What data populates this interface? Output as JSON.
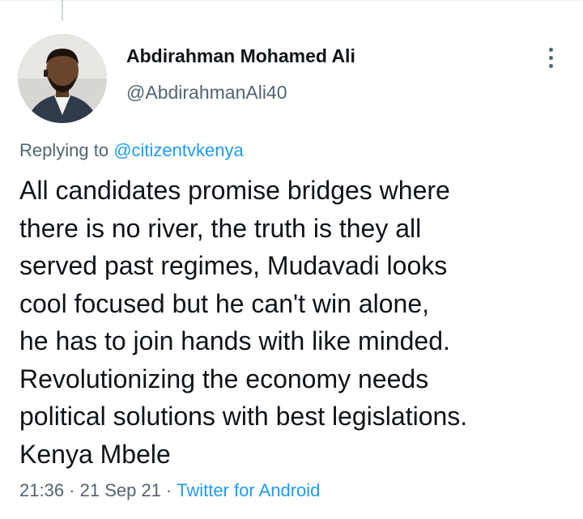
{
  "tweet": {
    "author": {
      "name": "Abdirahman Mohamed Ali",
      "handle": "@AbdirahmanAli40"
    },
    "replying_prefix": "Replying to ",
    "replying_to": "@citizentvkenya",
    "text": "All candidates promise bridges where\nthere is no river, the truth is they all\nserved past regimes, Mudavadi looks\ncool focused but he can't win alone,\nhe has to join hands with like minded.\nRevolutionizing the economy needs\npolitical solutions with best legislations.\nKenya Mbele",
    "time": "21:36",
    "separator": " · ",
    "date": "21 Sep 21",
    "source": "Twitter for Android"
  },
  "icons": {
    "more": "more-vertical-icon"
  },
  "colors": {
    "link": "#1d9bf0",
    "secondary": "#536471",
    "text": "#0f1419"
  }
}
